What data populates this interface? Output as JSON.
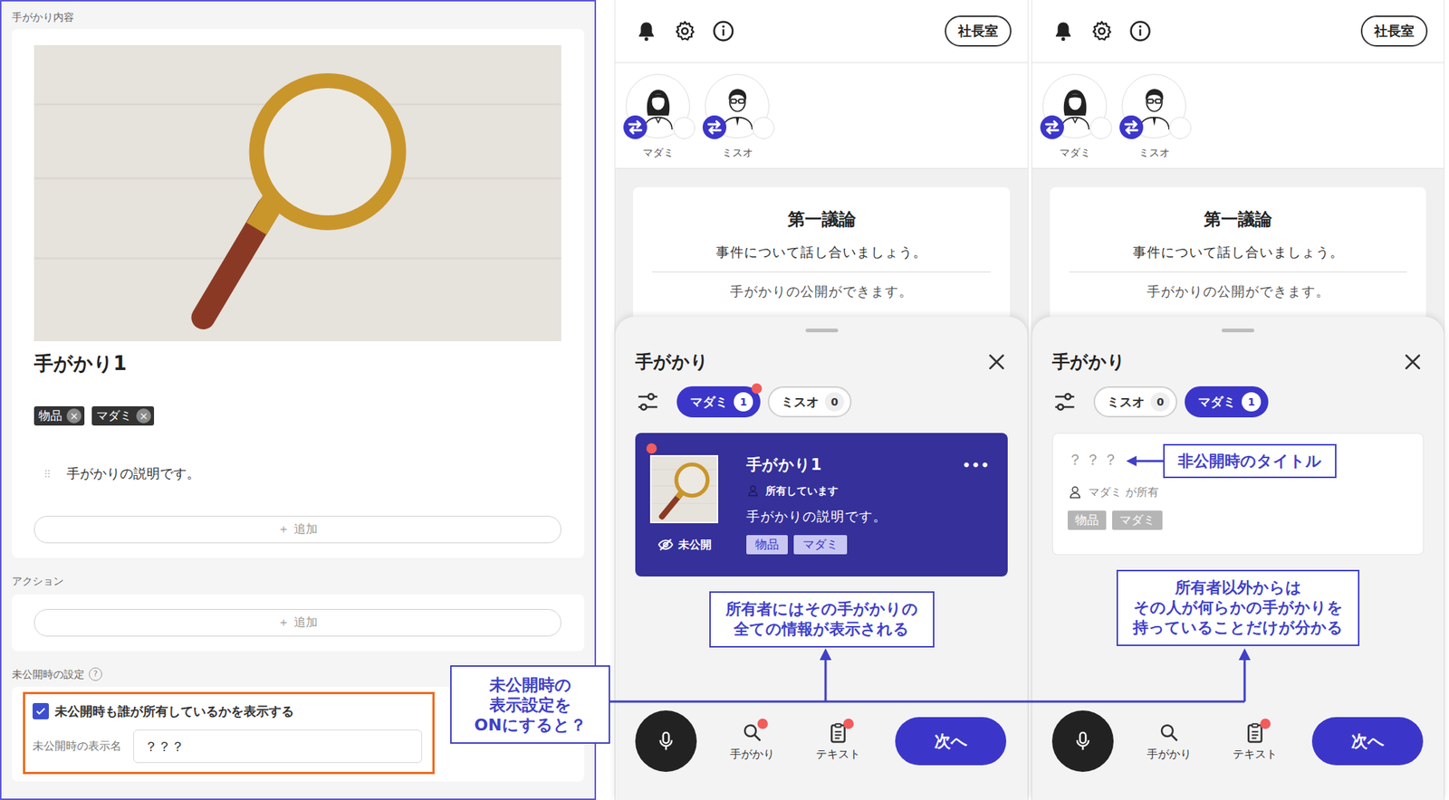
{
  "editor": {
    "section_label": "手がかり内容",
    "clue": {
      "title": "手がかり1",
      "tags": [
        {
          "label": "物品",
          "remove": "×"
        },
        {
          "label": "マダミ",
          "remove": "×"
        }
      ],
      "description": "手がかりの説明です。",
      "add_button": "＋ 追加"
    },
    "actions": {
      "label": "アクション",
      "add_button": "＋ 追加"
    },
    "unpublished": {
      "label": "未公開時の設定",
      "help": "?",
      "show_owner": {
        "label": "未公開時も誰が所有しているかを表示する",
        "checked": true
      },
      "display_name": {
        "label": "未公開時の表示名",
        "value": "？？？"
      }
    }
  },
  "callout": {
    "lines": [
      "未公開時の",
      "表示設定を",
      "ONにすると？"
    ]
  },
  "phones": [
    {
      "header": {
        "room_button": "社長室"
      },
      "players": [
        {
          "name": "マダミ",
          "kind": "woman"
        },
        {
          "name": "ミスオ",
          "kind": "man"
        }
      ],
      "phase": {
        "title": "第一議論",
        "subtitle": "事件について話し合いましょう。",
        "note": "手がかりの公開ができます。"
      },
      "sheet": {
        "title": "手がかり",
        "chips": [
          {
            "name": "マダミ",
            "count": "1",
            "selected": true,
            "unread": true
          },
          {
            "name": "ミスオ",
            "count": "0",
            "selected": false,
            "unread": false
          }
        ],
        "clue": {
          "kind": "full",
          "title": "手がかり1",
          "owner": "所有しています",
          "description": "手がかりの説明です。",
          "status": "未公開",
          "menu": "•••",
          "unread": true,
          "tags": [
            "物品",
            "マダミ"
          ]
        },
        "annotation": {
          "lines": [
            "所有者にはその手がかりの",
            "全ての情報が表示される"
          ]
        }
      },
      "nav": {
        "clues": {
          "label": "手がかり",
          "unread": true
        },
        "text": {
          "label": "テキスト",
          "unread": true
        },
        "next": "次へ"
      }
    },
    {
      "header": {
        "room_button": "社長室"
      },
      "players": [
        {
          "name": "マダミ",
          "kind": "woman"
        },
        {
          "name": "ミスオ",
          "kind": "man"
        }
      ],
      "phase": {
        "title": "第一議論",
        "subtitle": "事件について話し合いましょう。",
        "note": "手がかりの公開ができます。"
      },
      "sheet": {
        "title": "手がかり",
        "chips": [
          {
            "name": "ミスオ",
            "count": "0",
            "selected": false,
            "unread": false
          },
          {
            "name": "マダミ",
            "count": "1",
            "selected": true,
            "unread": false
          }
        ],
        "clue": {
          "kind": "hidden",
          "title": "？？？",
          "owner": "マダミ が所有",
          "tags": [
            "物品",
            "マダミ"
          ],
          "title_note": "非公開時のタイトル"
        },
        "annotation": {
          "lines": [
            "所有者以外からは",
            "その人が何らかの手がかりを",
            "持っていることだけが分かる"
          ]
        }
      },
      "nav": {
        "clues": {
          "label": "手がかり",
          "unread": false
        },
        "text": {
          "label": "テキスト",
          "unread": true
        },
        "next": "次へ"
      }
    }
  ]
}
